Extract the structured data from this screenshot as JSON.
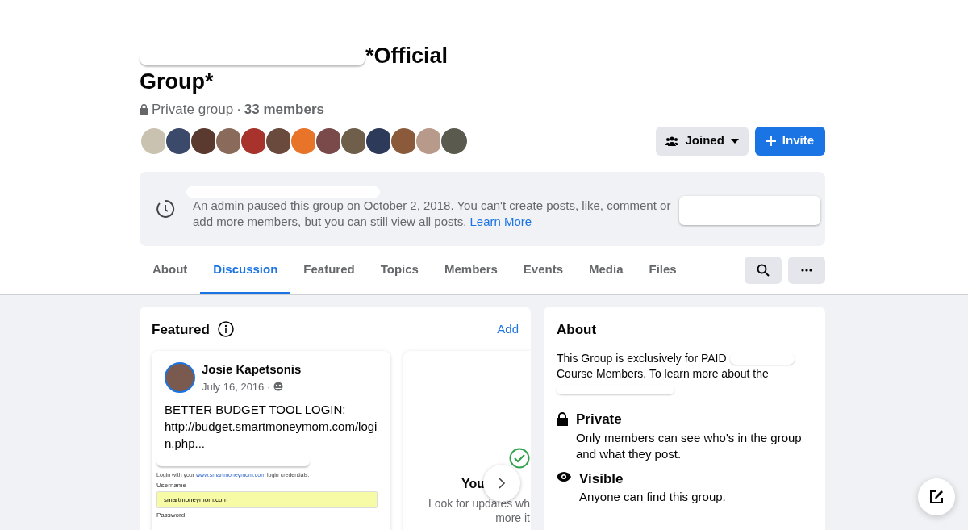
{
  "group": {
    "title_visible": "*Official",
    "title_line2": "Group*",
    "privacy": "Private group",
    "separator": "·",
    "members": "33 members"
  },
  "member_avatars": [
    {
      "color": "#c9c2b0"
    },
    {
      "color": "#3b4a6b"
    },
    {
      "color": "#5a3a2e"
    },
    {
      "color": "#8a6a5a"
    },
    {
      "color": "#a8322c"
    },
    {
      "color": "#6b4a3e"
    },
    {
      "color": "#e8742a"
    },
    {
      "color": "#7a4a4a"
    },
    {
      "color": "#6e5e4a"
    },
    {
      "color": "#2e3a5a"
    },
    {
      "color": "#8a5a3a"
    },
    {
      "color": "#b89a8a"
    },
    {
      "color": "#5a5a4e"
    }
  ],
  "buttons": [
    {
      "kind": "joined",
      "label": "Joined"
    },
    {
      "kind": "invite",
      "label": "Invite"
    }
  ],
  "banner": {
    "text": "An admin paused this group on October 2, 2018. You can't create posts, like, comment or",
    "text2": "add more members, but you can still view all posts.",
    "link": "Learn More"
  },
  "tabs": [
    {
      "label": "About",
      "selected": false
    },
    {
      "label": "Discussion",
      "selected": true
    },
    {
      "label": "Featured",
      "selected": false
    },
    {
      "label": "Topics",
      "selected": false
    },
    {
      "label": "Members",
      "selected": false
    },
    {
      "label": "Events",
      "selected": false
    },
    {
      "label": "Media",
      "selected": false
    },
    {
      "label": "Files",
      "selected": false
    }
  ],
  "featured": {
    "title": "Featured",
    "action": "Add",
    "post": {
      "author": "Josie Kapetsonis",
      "date": "July 16, 2016 ·",
      "text": "BETTER BUDGET TOOL LOGIN: http://budget.smartmoneymom.com/login.php...",
      "screenshot": {
        "intro": "Login with your",
        "intro_link": "www.smartmoneymom.com",
        "intro_end": "login credentials.",
        "username_label": "Username",
        "username_value": "smartmoneymom.com",
        "password_label": "Password"
      }
    },
    "second_card": {
      "title": "You",
      "line1": "Look for updates wh",
      "line2": "more it"
    }
  },
  "about": {
    "title": "About",
    "description": "This Group is exclusively for PAID",
    "description2": "Course Members. To learn more about the",
    "items": [
      {
        "kind": "private",
        "title": "Private",
        "text": "Only members can see who's in the group and what they post."
      },
      {
        "kind": "visible",
        "title": "Visible",
        "text": "Anyone can find this group."
      }
    ]
  }
}
